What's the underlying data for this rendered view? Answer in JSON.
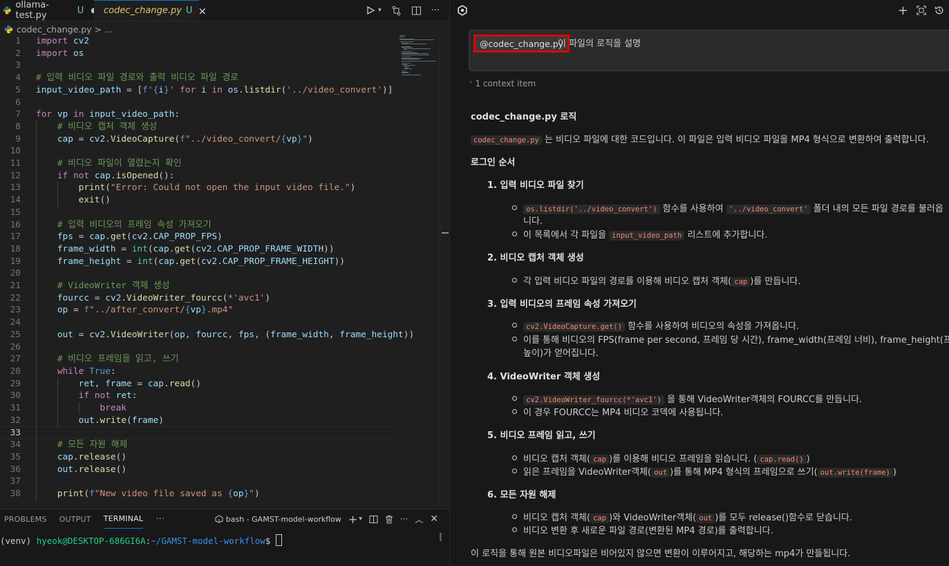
{
  "editor": {
    "tabs": [
      {
        "label": "ollama-test.py",
        "status": "U",
        "modified": "●"
      },
      {
        "label": "codec_change.py",
        "status": "U",
        "close": "×"
      }
    ],
    "breadcrumb": {
      "file": "codec_change.py",
      "sep": ">",
      "rest": "..."
    },
    "code_lines": [
      "import cv2",
      "import os",
      "",
      "# 입력 비디오 파일 경로와 출력 비디오 파일 경로",
      "input_video_path = [f'{i}' for i in os.listdir('../video_convert')]",
      "",
      "for vp in input_video_path:",
      "    # 비디오 캡처 객체 생성",
      "    cap = cv2.VideoCapture(f\"../video_convert/{vp}\")",
      "",
      "    # 비디오 파일이 열렸는지 확인",
      "    if not cap.isOpened():",
      "        print(\"Error: Could not open the input video file.\")",
      "        exit()",
      "",
      "    # 입력 비디오의 프레임 속성 가져오기",
      "    fps = cap.get(cv2.CAP_PROP_FPS)",
      "    frame_width = int(cap.get(cv2.CAP_PROP_FRAME_WIDTH))",
      "    frame_height = int(cap.get(cv2.CAP_PROP_FRAME_HEIGHT))",
      "",
      "    # VideoWriter 객체 생성",
      "    fourcc = cv2.VideoWriter_fourcc(*'avc1')",
      "    op = f\"../after_convert/{vp}.mp4\"",
      "",
      "    out = cv2.VideoWriter(op, fourcc, fps, (frame_width, frame_height))",
      "",
      "    # 비디오 프레임을 읽고, 쓰기",
      "    while True:",
      "        ret, frame = cap.read()",
      "        if not ret:",
      "            break",
      "        out.write(frame)",
      "",
      "    # 모든 자원 해제",
      "    cap.release()",
      "    out.release()",
      "",
      "    print(f\"New video file saved as {op}\")"
    ],
    "current_line": 33
  },
  "panel": {
    "tabs": [
      "PROBLEMS",
      "OUTPUT",
      "TERMINAL"
    ],
    "more": "···",
    "terminal_name": "bash - GAMST-model-workflow",
    "prompt": {
      "venv": "(venv) ",
      "user": "hyeok@DESKTOP-686GI6A",
      "colon": ":",
      "path": "~/GAMST-model-workflow",
      "dollar": "$ "
    }
  },
  "chat": {
    "mention": "@codec_change.py",
    "prompt_text": "이 파일의 로직을 설명",
    "context": "1 context item",
    "answer": {
      "heading": "codec_change.py 로직",
      "intro_code": "codec_change.py",
      "intro_text": "는 비디오 파일에 대한 코드입니다. 이 파일은 입력 비디오 파일을 MP4 형식으로 변환하여 출력합니다.",
      "order_heading": "로그인 순서",
      "s1": "1. 입력 비디오 파일 찾기",
      "s1b1_code": "os.listdir('../video_convert')",
      "s1b1_t1": " 함수를 사용하여 ",
      "s1b1_code2": "'../video_convert'",
      "s1b1_t2": " 폴더 내의 모든 파일 경로를 불러옵",
      "s1b1_cont": "니다.",
      "s1b2_t1": "이 목록에서 각 파일을 ",
      "s1b2_code": "input_video_path",
      "s1b2_t2": " 리스트에 추가합니다.",
      "s2": "2. 비디오 캡처 객체 생성",
      "s2b1_t1": "각 입력 비디오 파일의 경로를 이용해 비디오 캡처 객체(",
      "s2b1_code": "cap",
      "s2b1_t2": ")를 만듭니다.",
      "s3": "3. 입력 비디오의 프레임 속성 가져오기",
      "s3b1_code": "cv2.VideoCapture.get()",
      "s3b1_t": " 함수를 사용하여 비디오의 속성을 가져옵니다.",
      "s3b2_t": "이를 통해 비디오의 FPS(frame per second, 프레임 당 시간), frame_width(프레임 너비), frame_height(프레임",
      "s3b2_cont": "높이)가 얻어집니다.",
      "s4": "4. VideoWriter 객체 생성",
      "s4b1_code": "cv2.VideoWriter_fourcc(*'avc1')",
      "s4b1_t": " 을 통해 VideoWriter객체의 FOURCC를 만듭니다.",
      "s4b2_t": "이 경우 FOURCC는 MP4 비디오 코덱에 사용됩니다.",
      "s5": "5. 비디오 프레임 읽고, 쓰기",
      "s5b1_t1": "비디오 캡처 객체(",
      "s5b1_code": "cap",
      "s5b1_t2": ")를 이용해 비디오 프레임을 읽습니다. (",
      "s5b1_code2": "cap.read()",
      "s5b1_t3": ")",
      "s5b2_t1": "읽은 프레임을 VideoWriter객체(",
      "s5b2_code": "out",
      "s5b2_t2": ")를 통해 MP4 형식의 프레임으로 쓰기(",
      "s5b2_code2": "out.write(frame)",
      "s5b2_t3": ")",
      "s6": "6. 모든 자원 해제",
      "s6b1_t1": "비디오 캡처 객체(",
      "s6b1_code": "cap",
      "s6b1_t2": ")와 VideoWriter객체(",
      "s6b1_code2": "out",
      "s6b1_t3": ")를 모두 release()함수로 닫습니다.",
      "s6b2_t": "비디오 변환 후 새로운 파일 경로(변환된 MP4 경로)를 출력합니다.",
      "conclusion": "이 로직을 통해 원본 비디오파일은 비어있지 않으면 변환이 이루어지고, 해당하는 mp4가 만들됩니다."
    }
  },
  "colors": {
    "accent": "#0078d4",
    "highlight_border": "#e00000",
    "modified": "#73c991"
  }
}
